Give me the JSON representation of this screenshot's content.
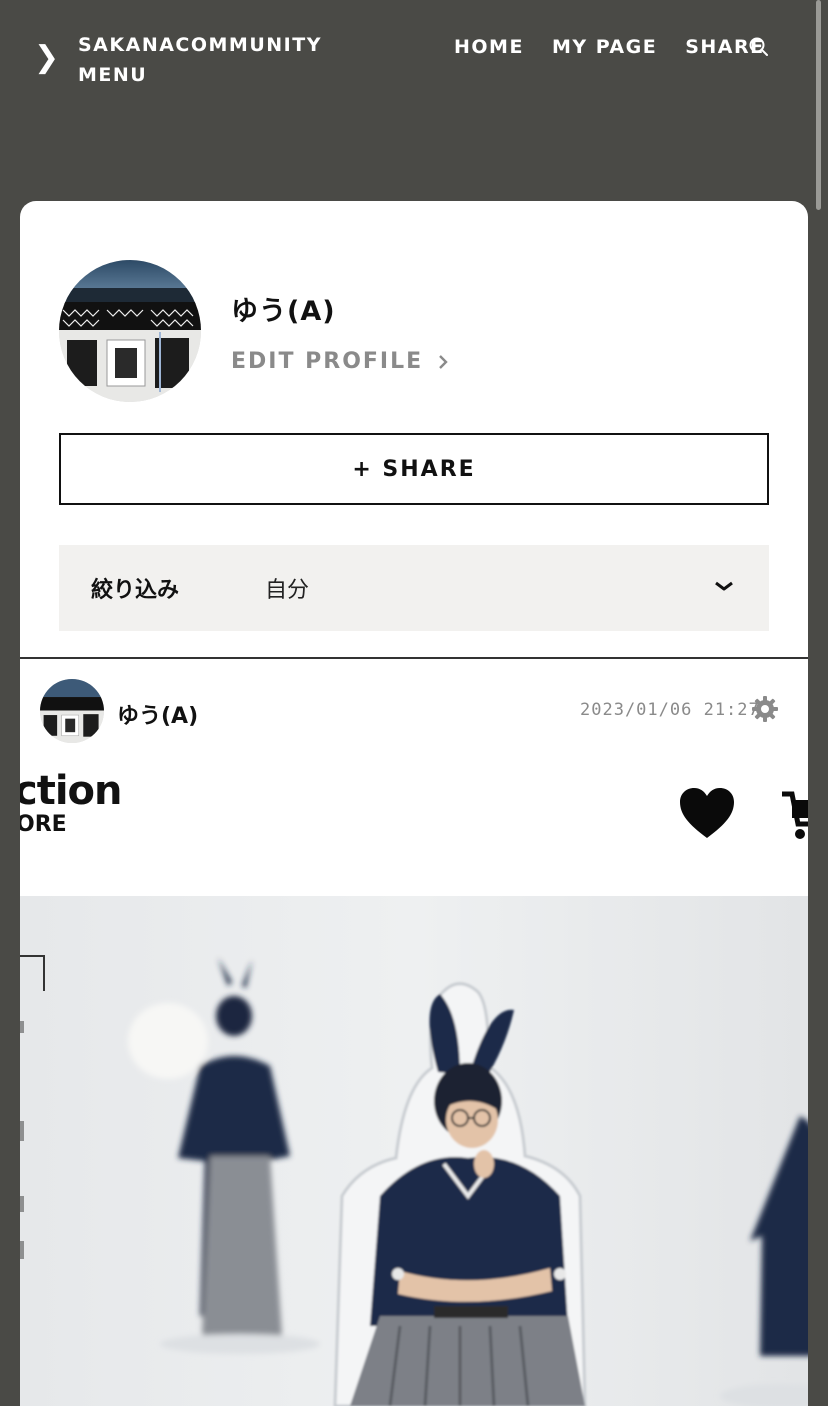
{
  "header": {
    "brand_line1": "SAKANACOMMUNITY",
    "brand_line2": "MENU",
    "nav": [
      {
        "label": "HOME"
      },
      {
        "label": "MY PAGE"
      },
      {
        "label": "SHARE"
      }
    ],
    "icons": {
      "menu": "chevron-right-icon",
      "search": "search-icon"
    }
  },
  "profile": {
    "name": "ゆう(A)",
    "edit_label": "EDIT PROFILE",
    "share_label": "+ SHARE"
  },
  "filter": {
    "label": "絞り込み",
    "value": "自分"
  },
  "post": {
    "user": "ゆう(A)",
    "timestamp": "2023/01/06 21:27",
    "image": {
      "brand_text": "ction",
      "brand_sub": "ORE"
    }
  },
  "colors": {
    "background": "#4a4a46",
    "card": "#ffffff",
    "filter_bg": "#f2f1ef",
    "muted_text": "#8a8a8a"
  }
}
